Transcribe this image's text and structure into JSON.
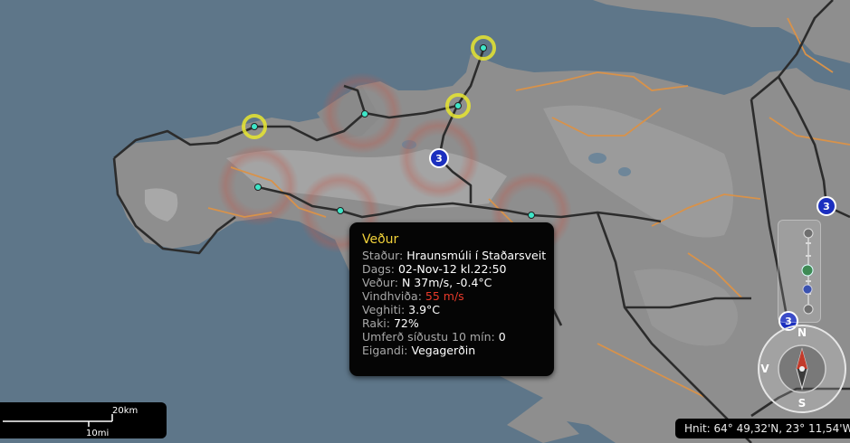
{
  "popup": {
    "title": "Veður",
    "location_label": "Staður:",
    "location_value": "Hraunsmúli í Staðarsveit",
    "date_label": "Dags:",
    "date_value": "02-Nov-12 kl.22:50",
    "weather_label": "Veður:",
    "weather_value": "N  37m/s,  -0.4°C",
    "gust_label": "Vindhviða:",
    "gust_value": "55 m/s",
    "road_temp_label": "Veghiti:",
    "road_temp_value": "3.9°C",
    "humidity_label": "Raki:",
    "humidity_value": "72%",
    "traffic_label": "Umferð síðustu 10 mín:",
    "traffic_value": "0",
    "owner_label": "Eigandi:",
    "owner_value": "Vegagerðin"
  },
  "scale": {
    "km_label": "20km",
    "mi_label": "10mi"
  },
  "coords": {
    "text": "Hnit: 64° 49,32'N, 23° 11,54'W"
  },
  "compass": {
    "north": "N",
    "south": "S",
    "west": "V"
  },
  "route_badges": [
    "3",
    "3",
    "3"
  ],
  "colors": {
    "sea": "#5e7689",
    "land": "#8d8d8d",
    "primary_road": "#2c2c2c",
    "secondary_road": "#d8924a",
    "station": "#3ee6c8",
    "alert_ring": "#e8e630",
    "route_badge": "#1b2fbf"
  }
}
